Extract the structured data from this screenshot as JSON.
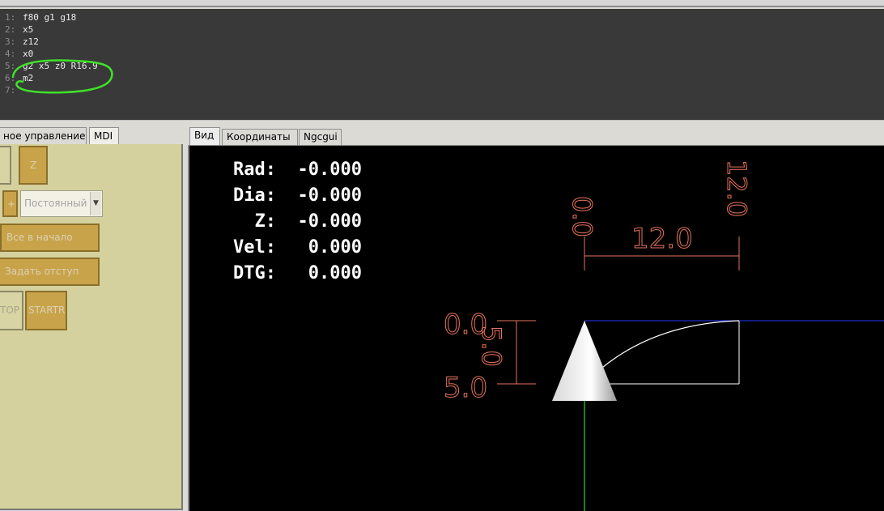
{
  "editor": {
    "lines": [
      {
        "num": "1:",
        "text": "f80 g1 g18"
      },
      {
        "num": "2:",
        "text": "x5"
      },
      {
        "num": "3:",
        "text": "z12"
      },
      {
        "num": "4:",
        "text": "x0"
      },
      {
        "num": "5:",
        "text": "g2 x5 z0 R16.9"
      },
      {
        "num": "6:",
        "text": "m2"
      },
      {
        "num": "7:",
        "text": ""
      }
    ],
    "annotation_color": "#3fe22a"
  },
  "left_tabs": [
    {
      "label": "ное управление"
    },
    {
      "label": "MDI"
    }
  ],
  "left_panel": {
    "z_button": "Z",
    "plus_button": "+",
    "jog_mode_select": "Постоянный",
    "home_all_button": "Все в начало",
    "set_offset_button": "Задать отступ",
    "stop_button": "TOP",
    "start_button": "STARTR"
  },
  "view_tabs": [
    {
      "label": "Вид"
    },
    {
      "label": "Координаты"
    },
    {
      "label": "Ngcgui"
    }
  ],
  "dro": [
    {
      "label": "Rad:",
      "value": "-0.000"
    },
    {
      "label": "Dia:",
      "value": "-0.000"
    },
    {
      "label": "  Z:",
      "value": "-0.000"
    },
    {
      "label": "Vel:",
      "value": " 0.000"
    },
    {
      "label": "DTG:",
      "value": " 0.000"
    }
  ],
  "dimensions": {
    "z_start": "0.0",
    "z_end": "12.0",
    "z_length": "12.0",
    "x_start": "0.0",
    "x_end": "5.0",
    "x_length": "5.0"
  },
  "colors": {
    "dimension": "#e8745c",
    "toolpath": "#ffffff",
    "z_axis": "#2233ff",
    "x_axis": "#33ff33",
    "background": "#000000"
  }
}
